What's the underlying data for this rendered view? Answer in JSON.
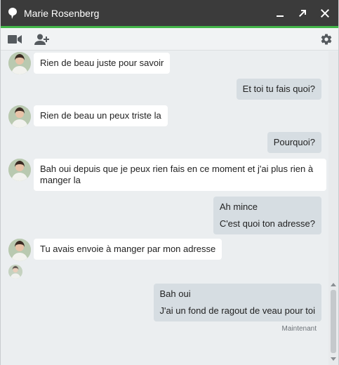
{
  "window": {
    "title": "Marie Rosenberg"
  },
  "icons": {
    "title_icon": "speech-bubble-icon",
    "minimize": "minimize-icon",
    "popout": "popout-arrow-icon",
    "close": "close-icon",
    "video": "video-camera-icon",
    "add_person": "add-person-icon",
    "settings": "gear-icon"
  },
  "colors": {
    "titlebar": "#3b3b3b",
    "accent_line": "#42b549",
    "incoming_bubble": "#ffffff",
    "outgoing_bubble": "#d6dde2",
    "background": "#ebeef0"
  },
  "messages": [
    {
      "from": "them",
      "lines": [
        "Rien de beau juste pour savoir"
      ]
    },
    {
      "from": "me",
      "lines": [
        "Et toi tu fais quoi?"
      ]
    },
    {
      "from": "them",
      "lines": [
        "Rien de beau un peux triste la"
      ]
    },
    {
      "from": "me",
      "lines": [
        "Pourquoi?"
      ]
    },
    {
      "from": "them",
      "lines": [
        "Bah oui depuis que je peux rien fais en ce moment et j'ai plus rien à",
        "manger la"
      ]
    },
    {
      "from": "me",
      "lines": [
        "Ah mince",
        "C'est quoi ton adresse?"
      ]
    },
    {
      "from": "them",
      "lines": [
        "Tu avais envoie à manger par mon adresse"
      ]
    },
    {
      "from": "me",
      "lines": [
        "Bah oui",
        "J'ai un fond de ragout de veau pour toi"
      ]
    }
  ],
  "timestamp": "Maintenant"
}
